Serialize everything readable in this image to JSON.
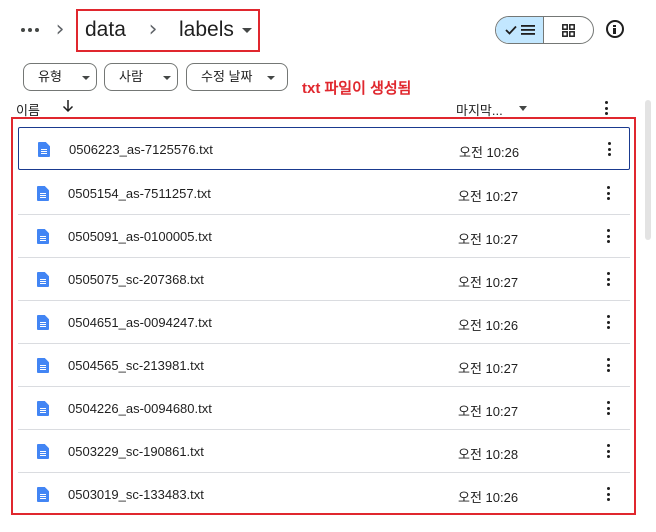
{
  "breadcrumb": {
    "items": [
      "data",
      "labels"
    ]
  },
  "filters": [
    "유형",
    "사람",
    "수정 날짜"
  ],
  "annotation": "txt 파일이 생성됨",
  "columns": {
    "name": "이름",
    "modified": "마지막..."
  },
  "files": [
    {
      "name": "0506223_as-7125576.txt",
      "time": "오전 10:26"
    },
    {
      "name": "0505154_as-7511257.txt",
      "time": "오전 10:27"
    },
    {
      "name": "0505091_as-0100005.txt",
      "time": "오전 10:27"
    },
    {
      "name": "0505075_sc-207368.txt",
      "time": "오전 10:27"
    },
    {
      "name": "0504651_as-0094247.txt",
      "time": "오전 10:26"
    },
    {
      "name": "0504565_sc-213981.txt",
      "time": "오전 10:27"
    },
    {
      "name": "0504226_as-0094680.txt",
      "time": "오전 10:27"
    },
    {
      "name": "0503229_sc-190861.txt",
      "time": "오전 10:28"
    },
    {
      "name": "0503019_sc-133483.txt",
      "time": "오전 10:26"
    }
  ],
  "icons": {
    "more": "more-horiz-icon",
    "separator": "chevron-right-icon",
    "dropdown": "arrow-drop-down-icon",
    "list_view": "list-view-icon",
    "grid_view": "grid-view-icon",
    "info": "info-icon",
    "sort": "arrow-down-icon",
    "file": "text-document-icon",
    "row_menu": "more-vert-icon"
  },
  "colors": {
    "accent": "#e0272e",
    "file_icon": "#4285f4",
    "toggle_selected": "#c2e7ff",
    "selection_border": "#1a3a8f"
  }
}
